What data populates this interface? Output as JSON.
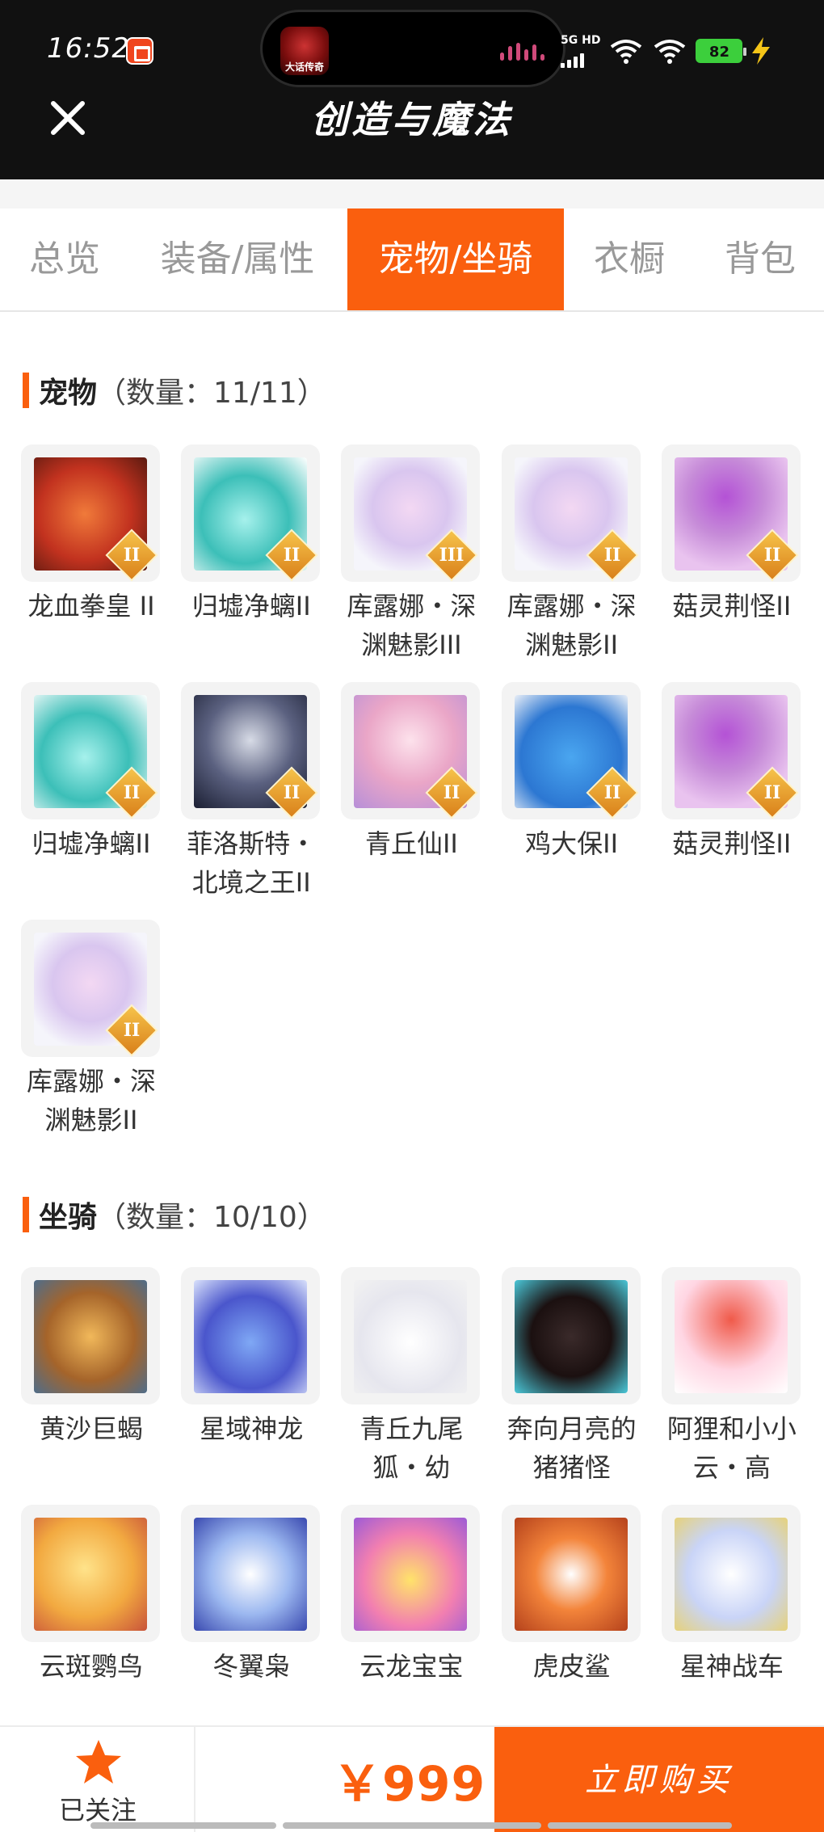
{
  "status_bar": {
    "time": "16:52",
    "network_label_top": "5G HD",
    "battery": "82"
  },
  "island": {
    "app_label": "大话传奇"
  },
  "header": {
    "title": "创造与魔法"
  },
  "tabs": [
    {
      "label": "总览",
      "active": false
    },
    {
      "label": "装备/属性",
      "active": false
    },
    {
      "label": "宠物/坐骑",
      "active": true
    },
    {
      "label": "衣橱",
      "active": false
    },
    {
      "label": "背包",
      "active": false
    }
  ],
  "pets": {
    "title": "宠物",
    "count": "（数量：11/11）",
    "items": [
      {
        "label": "龙血拳皇 II",
        "rank": "II",
        "icon": "red-dragon-pet"
      },
      {
        "label": "归墟净螭II",
        "rank": "II",
        "icon": "teal-dragon-pet"
      },
      {
        "label": "库露娜・深渊魅影III",
        "rank": "III",
        "icon": "white-hair-fairy-pet"
      },
      {
        "label": "库露娜・深渊魅影II",
        "rank": "II",
        "icon": "white-hair-fairy-pet"
      },
      {
        "label": "菇灵荆怪II",
        "rank": "II",
        "icon": "purple-hair-elf-pet"
      },
      {
        "label": "归墟净螭II",
        "rank": "II",
        "icon": "teal-dragon-pet"
      },
      {
        "label": "菲洛斯特・北境之王II",
        "rank": "II",
        "icon": "armored-warrior-pet"
      },
      {
        "label": "青丘仙II",
        "rank": "II",
        "icon": "fox-fairy-pet"
      },
      {
        "label": "鸡大保II",
        "rank": "II",
        "icon": "blue-bird-sunglasses-pet"
      },
      {
        "label": "菇灵荆怪II",
        "rank": "II",
        "icon": "purple-hair-elf-pet"
      },
      {
        "label": "库露娜・深渊魅影II",
        "rank": "II",
        "icon": "white-hair-fairy-pet"
      }
    ]
  },
  "mounts": {
    "title": "坐骑",
    "count": "（数量：10/10）",
    "items": [
      {
        "label": "黄沙巨蝎",
        "icon": "golden-scorpion-mount"
      },
      {
        "label": "星域神龙",
        "icon": "star-dragon-mount"
      },
      {
        "label": "青丘九尾狐・幼",
        "icon": "white-fox-mount"
      },
      {
        "label": "奔向月亮的猪猪怪",
        "icon": "black-pig-mount"
      },
      {
        "label": "阿狸和小小云・高",
        "icon": "red-fox-cloud-mount"
      },
      {
        "label": "云斑鹦鸟",
        "icon": "parrot-mount"
      },
      {
        "label": "冬翼枭",
        "icon": "snow-owl-mount"
      },
      {
        "label": "云龙宝宝",
        "icon": "baby-dragon-mount"
      },
      {
        "label": "虎皮鲨",
        "icon": "tiger-shark-mount"
      },
      {
        "label": "星神战车",
        "icon": "star-horse-mount"
      }
    ]
  },
  "bottom_bar": {
    "follow_label": "已关注",
    "price": "￥999",
    "buy_label": "立即购买"
  },
  "colors": {
    "accent": "#fa5f0e",
    "topbar": "#111111",
    "card_bg": "#f3f3f3"
  }
}
